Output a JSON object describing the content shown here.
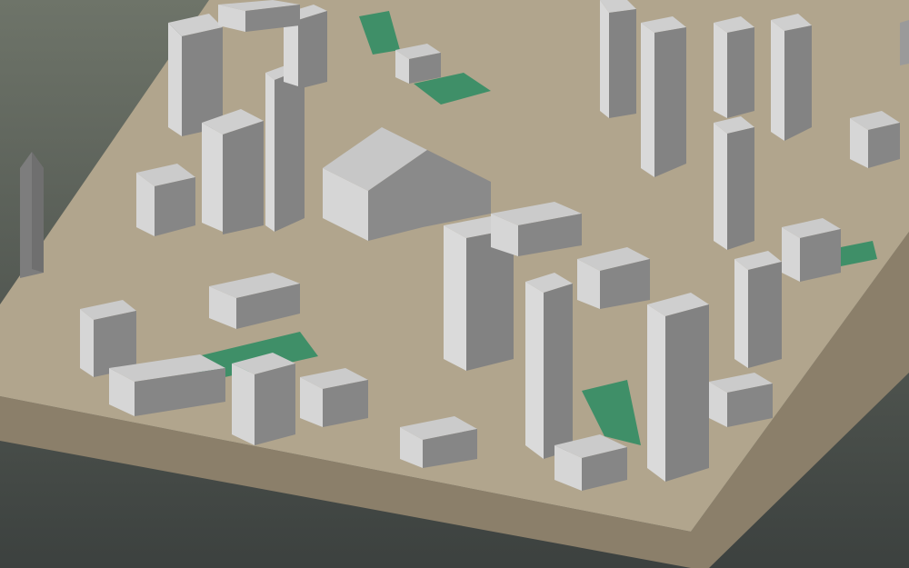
{
  "scene": {
    "kind": "3d-city-block-massing-model",
    "colors": {
      "sky_top": "#6d7369",
      "sky_bottom": "#3f4441",
      "ground_top": "#b5a88f",
      "ground_side": "#8c806b",
      "park": "#3f8f68",
      "roof": "#c9c9c9",
      "wall_light": "#d7d7d7",
      "wall_dark": "#7f7f7f"
    }
  }
}
